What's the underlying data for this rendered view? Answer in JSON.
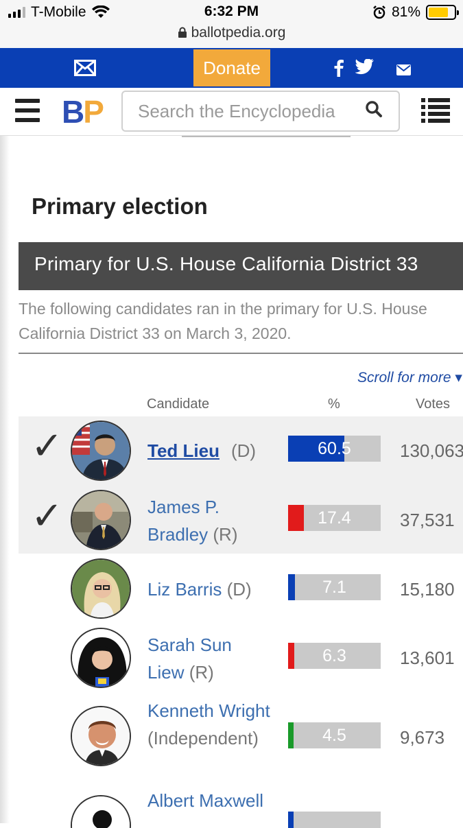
{
  "status": {
    "carrier": "T-Mobile",
    "time": "6:32 PM",
    "battery": "81%",
    "url": "ballotpedia.org"
  },
  "topbar": {
    "donate_label": "Donate",
    "icons": [
      "mail-icon",
      "facebook-icon",
      "twitter-icon",
      "email-icon"
    ]
  },
  "nav": {
    "logo_b": "B",
    "logo_p": "P",
    "search_placeholder": "Search the Encyclopedia"
  },
  "section": {
    "title": "Primary election",
    "race_header": "Primary for U.S. House California District 33",
    "description_line1": "The following candidates ran in the primary for U.S. House",
    "description_line2": "California District 33 on March 3, 2020.",
    "scroll_more": "Scroll for more ▾"
  },
  "table": {
    "headers": {
      "candidate": "Candidate",
      "percent": "%",
      "votes": "Votes"
    },
    "rows": [
      {
        "name": "Ted Lieu",
        "party": "(D)",
        "percent": "60.5",
        "votes": "130,063",
        "winner": true,
        "color": "#0a3fb4"
      },
      {
        "name": "James P. Bradley",
        "party": "(R)",
        "percent": "17.4",
        "votes": "37,531",
        "winner": true,
        "color": "#e11b1b"
      },
      {
        "name": "Liz Barris",
        "party": "(D)",
        "percent": "7.1",
        "votes": "15,180",
        "winner": false,
        "color": "#0a3fb4"
      },
      {
        "name": "Sarah Sun Liew",
        "party": "(R)",
        "percent": "6.3",
        "votes": "13,601",
        "winner": false,
        "color": "#e11b1b"
      },
      {
        "name": "Kenneth Wright",
        "party": "(Independent)",
        "percent": "4.5",
        "votes": "9,673",
        "winner": false,
        "color": "#1a9a2a"
      },
      {
        "name": "Albert Maxwell",
        "party": "",
        "percent": "",
        "votes": "",
        "winner": false,
        "color": "#0a3fb4"
      }
    ]
  }
}
